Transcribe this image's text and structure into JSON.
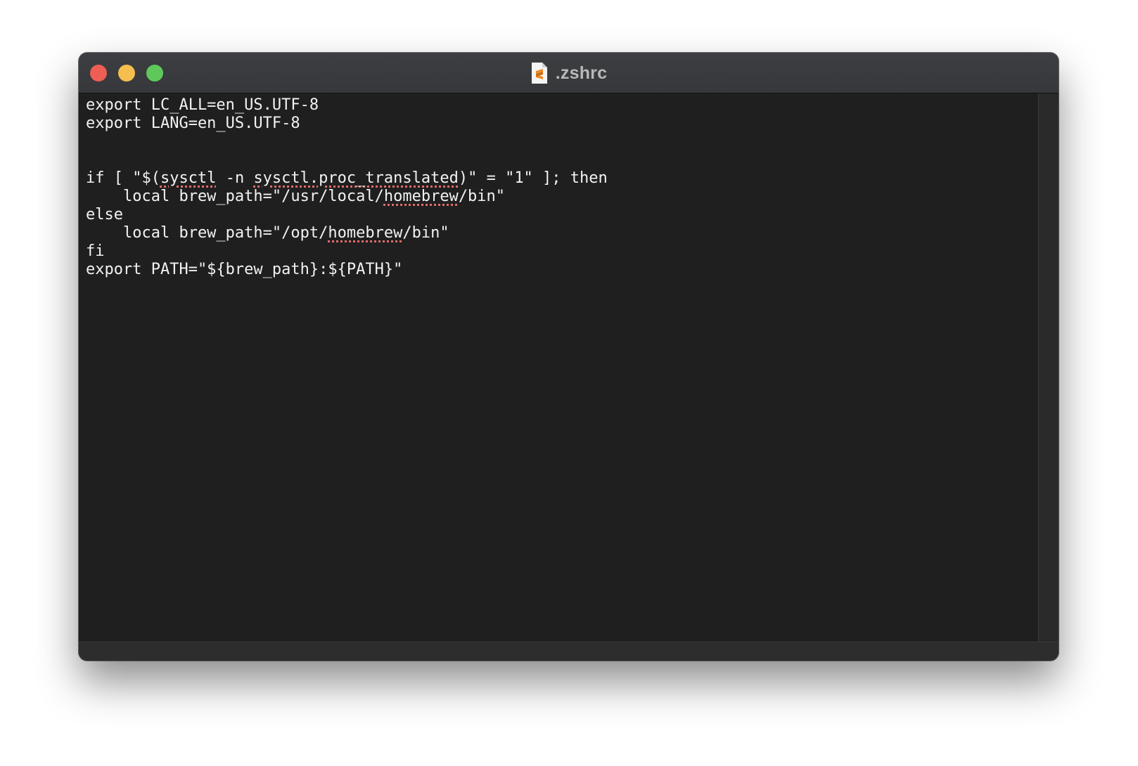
{
  "window": {
    "title": ".zshrc",
    "title_icon": "sublime-document-icon",
    "traffic_lights": {
      "close_color": "#ee5e55",
      "minimize_color": "#f6be4f",
      "zoom_color": "#5ec95a"
    }
  },
  "editor": {
    "lines": [
      [
        {
          "t": "export LC_ALL=en_US.UTF-8"
        }
      ],
      [
        {
          "t": "export LANG=en_US.UTF-8"
        }
      ],
      [],
      [],
      [
        {
          "t": "if [ \"$("
        },
        {
          "t": "sysctl",
          "spell": true
        },
        {
          "t": " -n "
        },
        {
          "t": "sysctl.proc_translated",
          "spell": true
        },
        {
          "t": ")\" = \"1\" ]; then"
        }
      ],
      [
        {
          "t": "    local brew_path=\"/usr/local/"
        },
        {
          "t": "homebrew",
          "spell": true
        },
        {
          "t": "/bin\""
        }
      ],
      [
        {
          "t": "else"
        }
      ],
      [
        {
          "t": "    local brew_path=\"/opt/"
        },
        {
          "t": "homebrew",
          "spell": true
        },
        {
          "t": "/bin\""
        }
      ],
      [
        {
          "t": "fi"
        }
      ],
      [
        {
          "t": "export PATH=\"${brew_path}:${PATH}\""
        }
      ]
    ],
    "spell_underline_color": "#e06c6c",
    "background": "#1f1f1f",
    "text_color": "#f2f2f2"
  }
}
